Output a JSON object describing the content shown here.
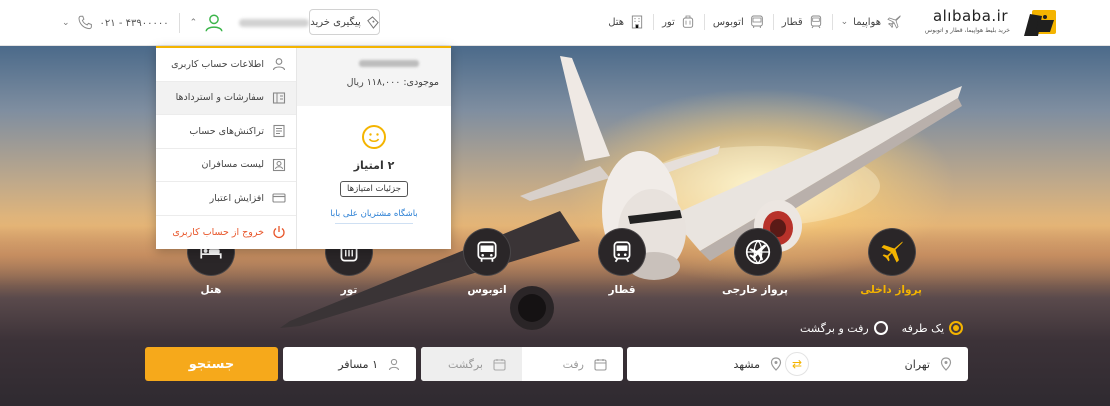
{
  "header": {
    "phone": "۰۲۱ - ۴۳۹۰۰۰۰۰",
    "track_label": "پیگیری خرید",
    "nav": [
      {
        "label": "هتل",
        "icon": "hotel-icon"
      },
      {
        "label": "تور",
        "icon": "tour-icon"
      },
      {
        "label": "اتوبوس",
        "icon": "bus-icon"
      },
      {
        "label": "قطار",
        "icon": "train-icon"
      },
      {
        "label": "هواپیما",
        "icon": "airplane-icon"
      }
    ],
    "logo_text": "alıbaba.ir",
    "logo_sub": "خرید بلیط هواپیما، قطار و اتوبوس"
  },
  "dropdown": {
    "menu": [
      {
        "label": "اطلاعات حساب کاربری",
        "icon": "user-icon"
      },
      {
        "label": "سفارشات و استردادها",
        "icon": "orders-icon"
      },
      {
        "label": "تراکنش‌های حساب",
        "icon": "transactions-icon"
      },
      {
        "label": "لیست مسافران",
        "icon": "passengers-icon"
      },
      {
        "label": "افزایش اعتبار",
        "icon": "credit-card-icon"
      },
      {
        "label": "خروج از حساب کاربری",
        "icon": "power-icon"
      }
    ],
    "balance": "موجودی: ۱۱۸,۰۰۰ ریال",
    "points": "۲ امتیاز",
    "points_button": "جزئیات امتیازها",
    "club_link": "باشگاه مشتریان علی بابا"
  },
  "categories": [
    {
      "label": "پرواز داخلی",
      "icon": "domestic-flight-icon",
      "active": true
    },
    {
      "label": "پرواز خارجی",
      "icon": "international-flight-icon",
      "active": false
    },
    {
      "label": "قطار",
      "icon": "train-icon",
      "active": false
    },
    {
      "label": "اتوبوس",
      "icon": "bus-icon",
      "active": false
    },
    {
      "label": "تور",
      "icon": "tour-icon",
      "active": false
    },
    {
      "label": "هتل",
      "icon": "hotel-icon",
      "active": false
    }
  ],
  "trip_type": {
    "one_way": "یک طرفه",
    "round_trip": "رفت و برگشت",
    "selected": "one_way"
  },
  "search": {
    "origin": "تهران",
    "destination": "مشهد",
    "depart_placeholder": "رفت",
    "return_placeholder": "برگشت",
    "passengers": "۱ مسافر",
    "button": "جستجو"
  },
  "colors": {
    "accent": "#f4b400",
    "search_button": "#f6a91b",
    "logout": "#e8562a",
    "link": "#2a7fd4",
    "user_icon": "#3bb54a"
  }
}
